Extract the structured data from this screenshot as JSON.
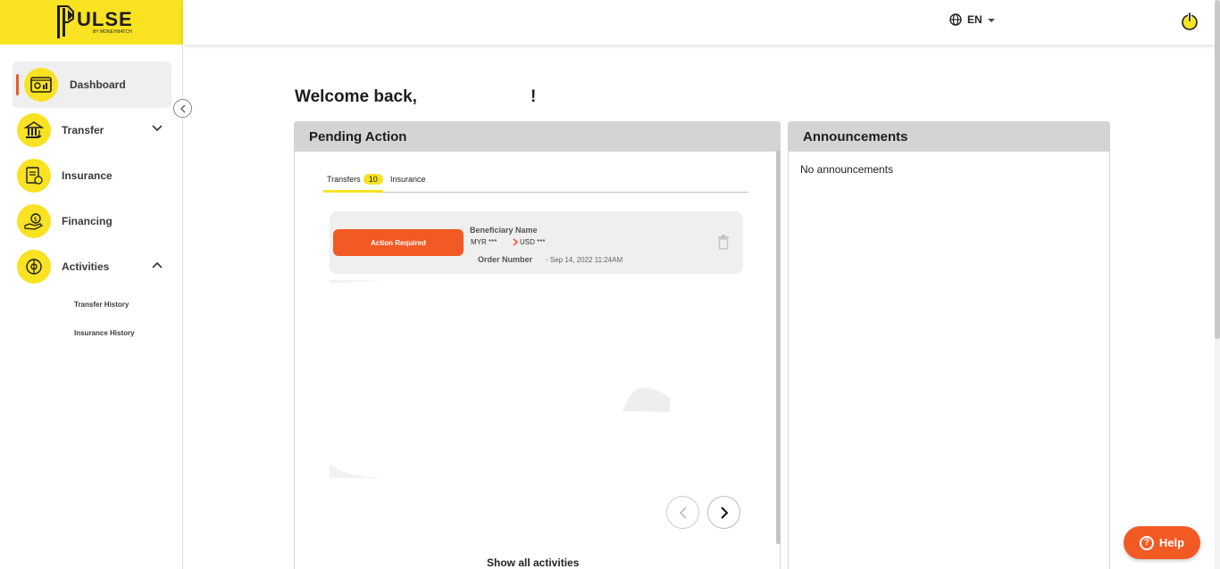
{
  "logo": {
    "word": "ULSE",
    "sub": "BY MONEYMATCH"
  },
  "header": {
    "language": "EN"
  },
  "sidebar": {
    "items": [
      {
        "label": "Dashboard"
      },
      {
        "label": "Transfer"
      },
      {
        "label": "Insurance"
      },
      {
        "label": "Financing"
      },
      {
        "label": "Activities"
      }
    ],
    "sub_items": [
      {
        "label": "Transfer History"
      },
      {
        "label": "Insurance History"
      }
    ]
  },
  "main": {
    "welcome": "Welcome back,",
    "welcome_end": "!",
    "pending": {
      "title": "Pending Action",
      "tabs": [
        {
          "label": "Transfers",
          "badge": "10"
        },
        {
          "label": "Insurance"
        }
      ],
      "card": {
        "status": "Action Required",
        "beneficiary": "Beneficiary Name",
        "from": "MYR ***",
        "to": "USD ***",
        "order": "Order Number",
        "date": "- Sep 14, 2022 11:24AM"
      },
      "show_all": "Show all activities"
    },
    "announcements": {
      "title": "Announcements",
      "empty": "No announcements"
    }
  },
  "help": {
    "label": "Help"
  },
  "colors": {
    "brand_yellow": "#f8e222",
    "accent_orange": "#f25a24"
  }
}
